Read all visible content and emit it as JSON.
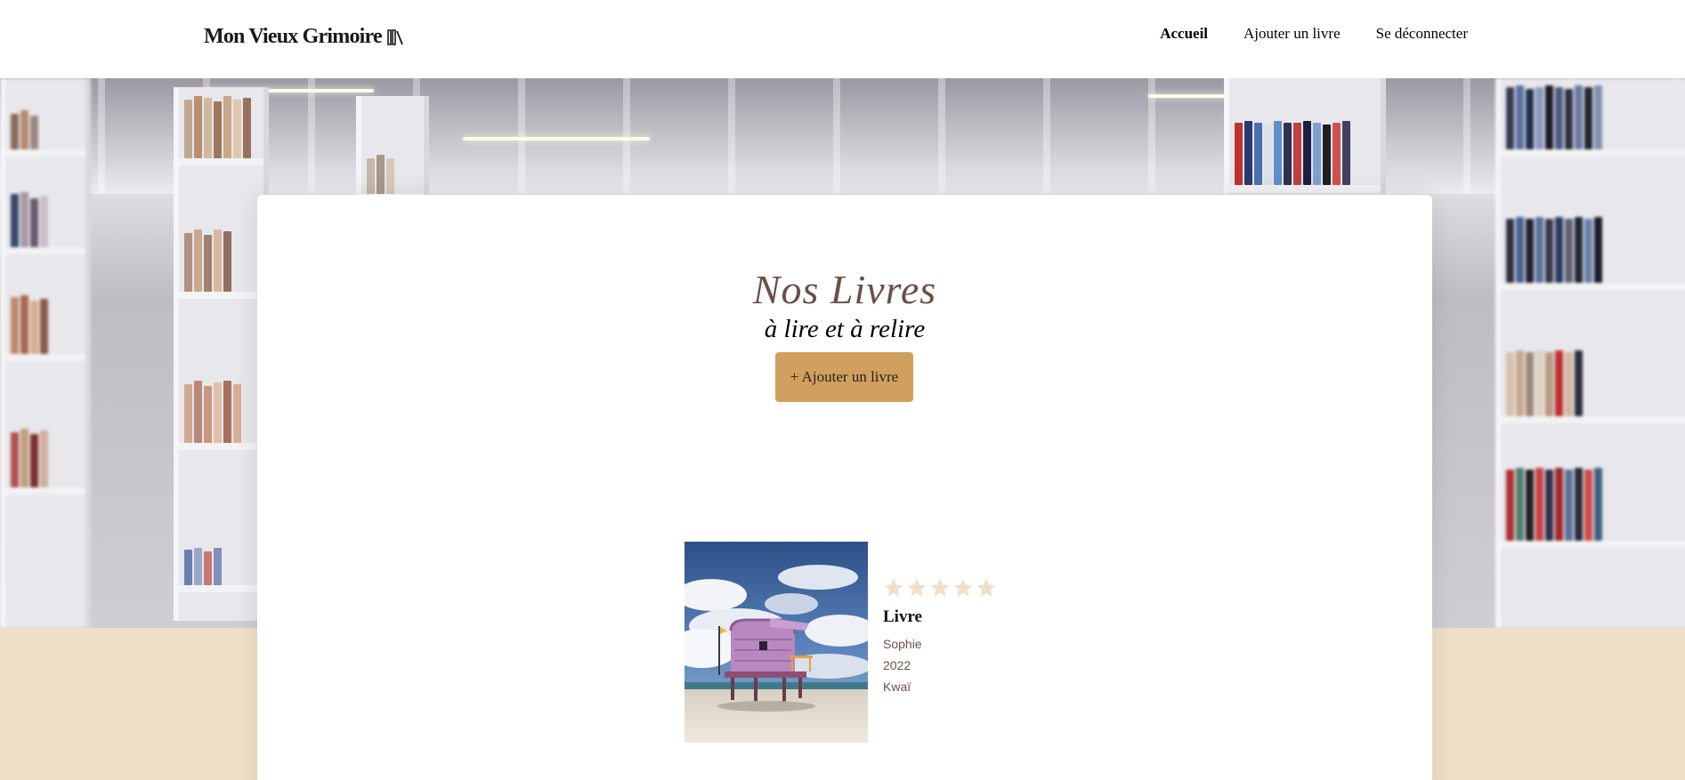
{
  "header": {
    "logo_text": "Mon Vieux Grimoire",
    "nav": [
      {
        "label": "Accueil",
        "active": true
      },
      {
        "label": "Ajouter un livre",
        "active": false
      },
      {
        "label": "Se déconnecter",
        "active": false
      }
    ]
  },
  "main": {
    "title": "Nos Livres",
    "subtitle": "à lire et à relire",
    "add_button_label": "+ Ajouter un livre"
  },
  "books": [
    {
      "title": "Livre",
      "author": "Sophie",
      "year": "2022",
      "genre": "Kwaï",
      "rating": 0,
      "max_rating": 5
    }
  ],
  "colors": {
    "title": "#6b4f48",
    "button": "#d2a05e",
    "beige_background": "#f0e0c9",
    "star_empty": "#f0e0c9"
  }
}
